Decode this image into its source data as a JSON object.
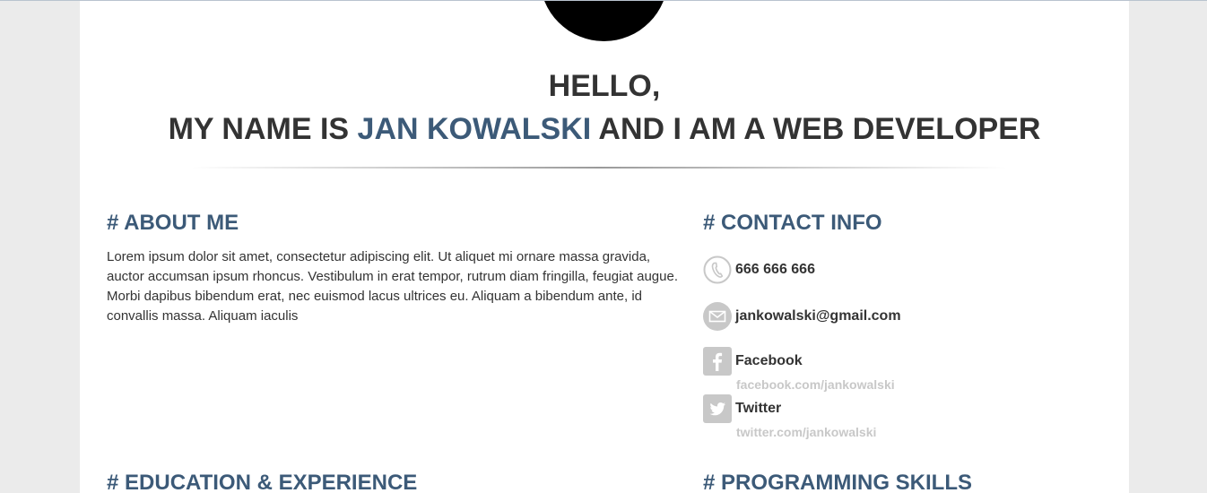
{
  "hero": {
    "line1": "HELLO,",
    "line2_prefix": "MY NAME IS ",
    "name": "JAN KOWALSKI",
    "line2_suffix": " AND I AM A WEB DEVELOPER"
  },
  "about": {
    "title": "# ABOUT ME",
    "text": "Lorem ipsum dolor sit amet, consectetur adipiscing elit. Ut aliquet mi ornare massa gravida, auctor accumsan ipsum rhoncus. Vestibulum in erat tempor, rutrum diam fringilla, feugiat augue. Morbi dapibus bibendum erat, nec euismod lacus ultrices eu. Aliquam a bibendum ante, id convallis massa. Aliquam iaculis"
  },
  "contact": {
    "title": "# CONTACT INFO",
    "phone": "666 666 666",
    "email": "jankowalski@gmail.com",
    "facebook": {
      "label": "Facebook",
      "url": "facebook.com/jankowalski"
    },
    "twitter": {
      "label": "Twitter",
      "url": "twitter.com/jankowalski"
    }
  },
  "education": {
    "title": "# EDUCATION & EXPERIENCE"
  },
  "skills": {
    "title": "# PROGRAMMING SKILLS"
  },
  "icons": {
    "phone": "phone-icon",
    "email": "mail-icon",
    "facebook": "facebook-icon",
    "twitter": "twitter-icon"
  },
  "colors": {
    "accent": "#3c5a78",
    "text": "#333333",
    "icon": "#c8c8c8",
    "background": "#ebebeb"
  }
}
